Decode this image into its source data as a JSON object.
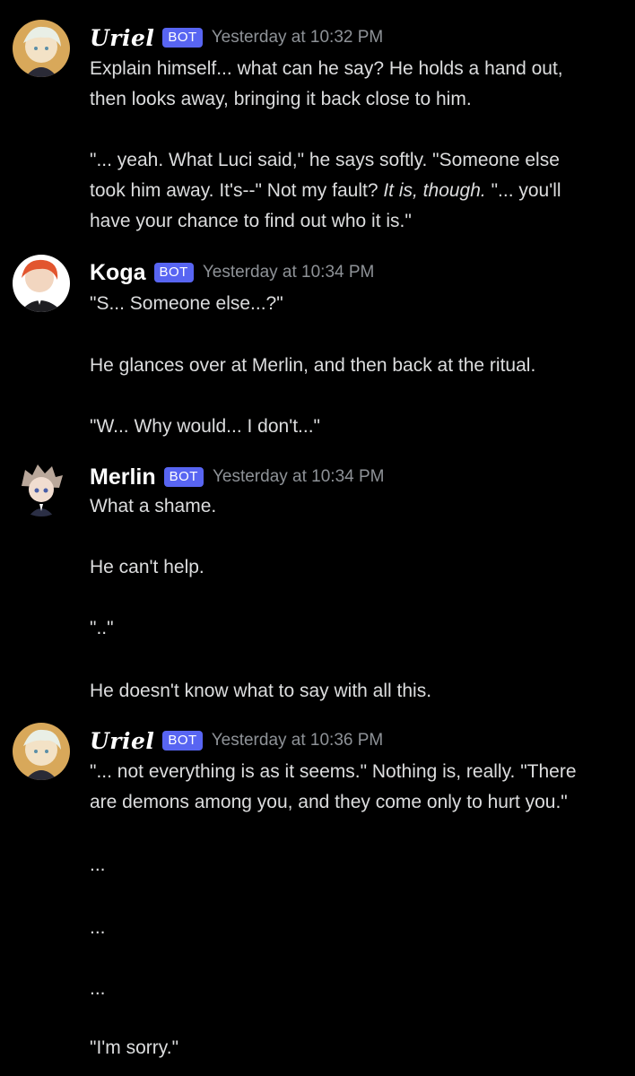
{
  "messages": [
    {
      "author": "Uriel",
      "badge": "BOT",
      "timestamp": "Yesterday at 10:32 PM",
      "lines": [
        "Explain himself... what can he say? He holds a hand out,",
        "then looks away, bringing it back close to him.",
        "\"... yeah. What Luci said,\" he says softly. \"Someone else",
        "took him away. It's--\" Not my fault? ",
        "It is, though.",
        " \"... you'll",
        "have your chance to find out who it is.\""
      ]
    },
    {
      "author": "Koga",
      "badge": "BOT",
      "timestamp": "Yesterday at 10:34 PM",
      "lines": [
        "\"S... Someone else...?\"",
        "He glances over at Merlin, and then back at the ritual.",
        "\"W... Why would... I don't...\""
      ]
    },
    {
      "author": "Merlin",
      "badge": "BOT",
      "timestamp": "Yesterday at 10:34 PM",
      "lines": [
        "What a shame.",
        "He can't help.",
        "\"..\"",
        "He doesn't know what to say with all this."
      ]
    },
    {
      "author": "Uriel",
      "badge": "BOT",
      "timestamp": "Yesterday at 10:36 PM",
      "lines": [
        "\"... not everything is as it seems.\" Nothing is, really. \"There",
        "are demons among you, and they come only to hurt you.\"",
        "...",
        "...",
        "...",
        "\"I'm sorry.\""
      ]
    }
  ]
}
